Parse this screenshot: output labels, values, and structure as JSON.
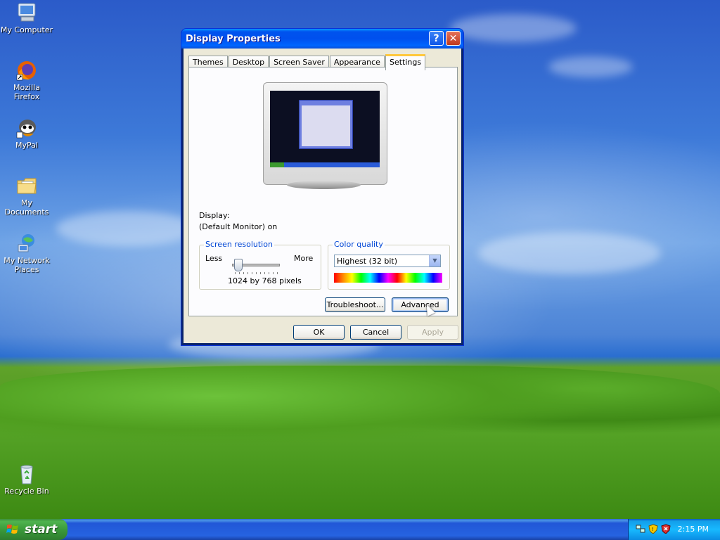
{
  "desktop": {
    "icons": [
      {
        "label": "My Computer"
      },
      {
        "label": "Mozilla Firefox"
      },
      {
        "label": "MyPal"
      },
      {
        "label": "My Documents"
      },
      {
        "label": "My Network Places"
      },
      {
        "label": "Recycle Bin"
      }
    ]
  },
  "window": {
    "title": "Display Properties",
    "help_glyph": "?",
    "close_glyph": "✕",
    "tabs": [
      {
        "label": "Themes"
      },
      {
        "label": "Desktop"
      },
      {
        "label": "Screen Saver"
      },
      {
        "label": "Appearance"
      },
      {
        "label": "Settings",
        "active": true
      }
    ],
    "settings": {
      "display_label": "Display:",
      "display_value": "(Default Monitor) on",
      "resolution_group": "Screen resolution",
      "less_label": "Less",
      "more_label": "More",
      "resolution_value": "1024 by 768 pixels",
      "resolution_slider_level": 0,
      "color_group": "Color quality",
      "color_value": "Highest (32 bit)",
      "troubleshoot_label": "Troubleshoot...",
      "advanced_label": "Advanced"
    },
    "buttons": {
      "ok": "OK",
      "cancel": "Cancel",
      "apply": "Apply"
    }
  },
  "taskbar": {
    "start_label": "start",
    "clock": "2:15 PM"
  },
  "colors": {
    "title_bar": "#0053ee",
    "start_button": "#3b9a3b",
    "taskbar": "#2457d7",
    "tab_highlight": "#ffc83c",
    "group_title": "#0046d5"
  }
}
